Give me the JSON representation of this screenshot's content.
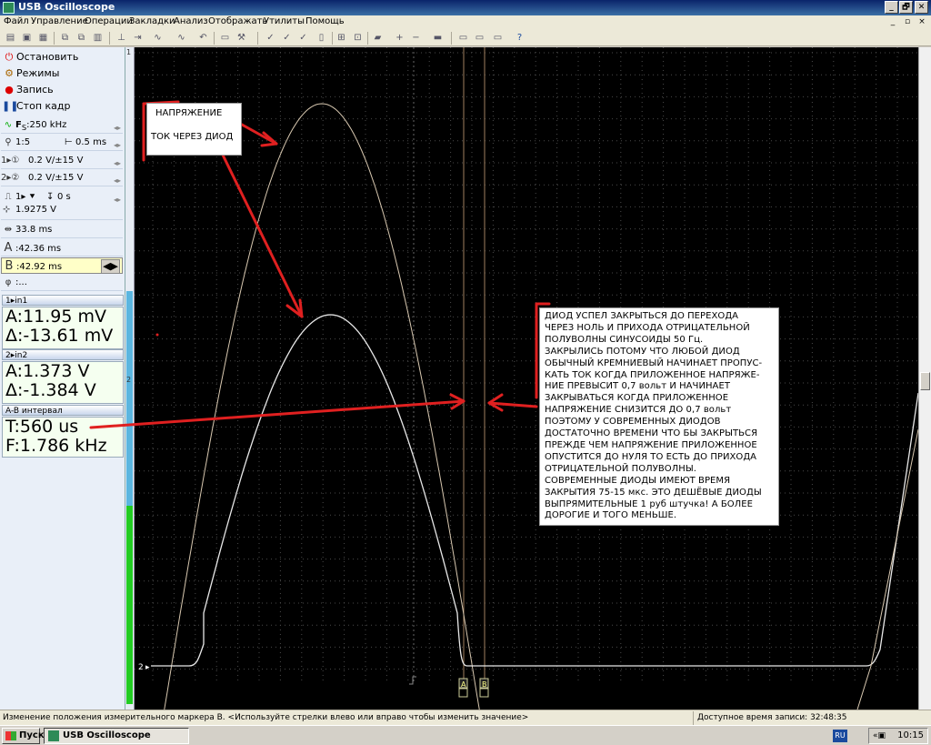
{
  "window": {
    "title": "USB Oscilloscope",
    "buttons": [
      "_",
      "🗗",
      "✕"
    ]
  },
  "menu": {
    "items": [
      "Файл",
      "Управление",
      "Операции",
      "Закладки",
      "Анализ",
      "Отображать",
      "Утилиты",
      "Помощь"
    ]
  },
  "controls": {
    "stop": "Остановить",
    "modes": "Режимы",
    "record": "Запись",
    "freeze": "Стоп кадр"
  },
  "settings": {
    "sample_rate": "250 kHz",
    "zoom": "1:5",
    "timebase": "0.5 ms",
    "ch1": "0.2 V/±15 V",
    "ch2": "0.2 V/±15 V",
    "trigger_time": "0 s",
    "trigger_level": "1.9275 V",
    "window_span": "33.8 ms",
    "marker_a": "42.36 ms",
    "marker_b": "42.92 ms",
    "phase": "..."
  },
  "readouts": {
    "ch1_header": "in1",
    "ch1_a": "A:11.95 mV",
    "ch1_delta": "Δ:-13.61 mV",
    "ch2_header": "in2",
    "ch2_a": "A:1.373 V",
    "ch2_delta": "Δ:-1.384 V",
    "ab_header": "A-B интервал",
    "ab_t": "T:560 us",
    "ab_f": "F:1.786 kHz"
  },
  "annotations": {
    "callout1_line1": "НАПРЯЖЕНИЕ",
    "callout1_line2": "ТОК ЧЕРЕЗ ДИОД",
    "callout2_lines": [
      "ДИОД   УСПЕЛ  ЗАКРЫТЬСЯ  ДО  ПЕРЕХОДА",
      "ЧЕРЕЗ  НОЛЬ  И  ПРИХОДА  ОТРИЦАТЕЛЬНОЙ",
      "ПОЛУВОЛНЫ  СИНУСОИДЫ  50 Гц.",
      "ЗАКРЫЛИСЬ ПОТОМУ ЧТО ЛЮБОЙ ДИОД",
      "ОБЫЧНЫЙ  КРЕМНИЕВЫЙ  НАЧИНАЕТ ПРОПУС-",
      "КАТЬ  ТОК  КОГДА  ПРИЛОЖЕННОЕ  НАПРЯЖЕ-",
      "НИЕ  ПРЕВЫСИТ  0,7 вольт  И  НАЧИНАЕТ",
      " ЗАКРЫВАТЬСЯ  КОГДА  ПРИЛОЖЕННОЕ",
      "НАПРЯЖЕНИЕ  СНИЗИТСЯ  ДО  0,7  вольт",
      "ПОЭТОМУ  У  СОВРЕМЕННЫХ  ДИОДОВ",
      "ДОСТАТОЧНО ВРЕМЕНИ ЧТО БЫ ЗАКРЫТЬСЯ",
      "ПРЕЖДЕ  ЧЕМ  НАПРЯЖЕНИЕ  ПРИЛОЖЕННОЕ",
      "ОПУСТИТСЯ  ДО  НУЛЯ  ТО  ЕСТЬ  ДО  ПРИХОДА",
      "ОТРИЦАТЕЛЬНОЙ  ПОЛУВОЛНЫ.",
      "СОВРЕМЕННЫЕ  ДИОДЫ  ИМЕЮТ  ВРЕМЯ",
      "ЗАКРЫТИЯ  75-15 мкс.   ЭТО  ДЕШЁВЫЕ  ДИОДЫ",
      "ВЫПРЯМИТЕЛЬНЫЕ   1 руб  штучка!  А  БОЛЕЕ",
      "ДОРОГИЕ  И ТОГО  МЕНЬШЕ."
    ]
  },
  "scope": {
    "ch2_marker": "2",
    "marker_a_label": "A",
    "marker_b_label": "B",
    "trace_color": "#e8e8e8",
    "grid_color": "#4a4a4a",
    "annotation_color": "#e02020"
  },
  "status": {
    "message": "Изменение положения измерительного маркера В.  <Используйте стрелки влево или вправо чтобы изменить значение>",
    "record_time": "Доступное время записи: 32:48:35"
  },
  "taskbar": {
    "start": "Пуск",
    "app": "USB Oscilloscope",
    "lang": "RU",
    "clock": "10:15"
  }
}
